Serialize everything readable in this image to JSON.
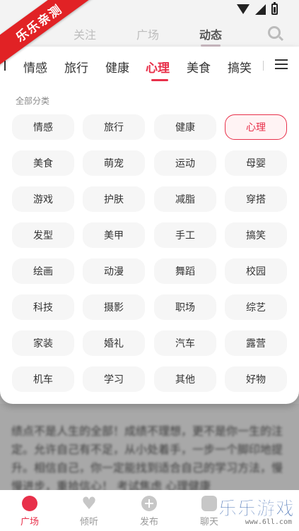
{
  "watermark": {
    "ribbon_text": "乐乐亲测",
    "logo_text": "乐乐游戏",
    "logo_url": "www.6ll.com"
  },
  "top_nav": {
    "tabs": [
      "关注",
      "广场",
      "动态"
    ],
    "active_index": 2
  },
  "category_bar": {
    "tabs": [
      "情感",
      "旅行",
      "健康",
      "心理",
      "美食",
      "搞笑"
    ],
    "active_index": 3
  },
  "panel": {
    "section_title": "全部分类",
    "categories": [
      "情感",
      "旅行",
      "健康",
      "心理",
      "美食",
      "萌宠",
      "运动",
      "母婴",
      "游戏",
      "护肤",
      "减脂",
      "穿搭",
      "发型",
      "美甲",
      "手工",
      "搞笑",
      "绘画",
      "动漫",
      "舞蹈",
      "校园",
      "科技",
      "摄影",
      "职场",
      "综艺",
      "家装",
      "婚礼",
      "汽车",
      "露营",
      "机车",
      "学习",
      "其他",
      "好物"
    ],
    "selected_index": 3
  },
  "feed": {
    "text": "绩点不是人生的全部！成绩不理想，更不是你一生的注定。允许自己有不足，从小处着手，一步一个脚印地提升。相信自己，你一定能找到适合自己的学习方法，慢慢进步，重拾信心！ 考试焦虑 心理健康"
  },
  "bottom_nav": {
    "items": [
      {
        "label": "广场",
        "icon": "square-icon"
      },
      {
        "label": "倾听",
        "icon": "heart-icon"
      },
      {
        "label": "发布",
        "icon": "plus-icon"
      },
      {
        "label": "聊天",
        "icon": "chat-icon"
      }
    ],
    "active_index": 0
  },
  "colors": {
    "accent": "#e8304a",
    "ribbon": "#e12225"
  }
}
